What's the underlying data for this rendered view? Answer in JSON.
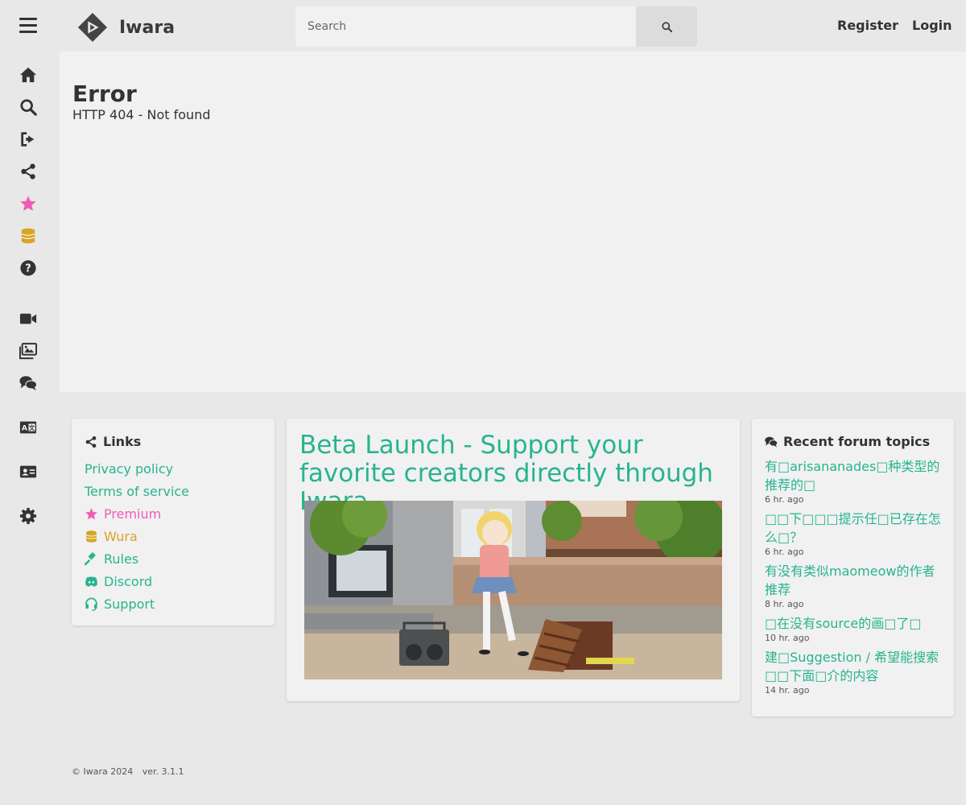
{
  "header": {
    "logo_text": "Iwara",
    "search_placeholder": "Search",
    "register_label": "Register",
    "login_label": "Login"
  },
  "sidebar": {
    "items": [
      "home-icon",
      "search-icon",
      "sign-out-icon",
      "share-icon",
      "star-icon",
      "coins-icon",
      "question-icon",
      "video-icon",
      "images-icon",
      "comments-icon",
      "language-icon",
      "id-card-icon",
      "gear-icon"
    ]
  },
  "error": {
    "title": "Error",
    "message": "HTTP 404 - Not found"
  },
  "links_card": {
    "heading": "Links",
    "items": {
      "privacy": "Privacy policy",
      "terms": "Terms of service",
      "premium": "Premium",
      "wura": "Wura",
      "rules": "Rules",
      "discord": "Discord",
      "support": "Support"
    }
  },
  "beta_card": {
    "title": "Beta Launch - Support your favorite creators directly through Iwara"
  },
  "forum_card": {
    "heading": "Recent forum topics",
    "topics": [
      {
        "title": "有□arisananades□种类型的推荐的□",
        "time": "6 hr. ago"
      },
      {
        "title": "□□下□□□提示任□已存在怎么□？",
        "time": "6 hr. ago"
      },
      {
        "title": "有没有类似maomeow的作者推荐",
        "time": "8 hr. ago"
      },
      {
        "title": "□在没有source的画□了□",
        "time": "10 hr. ago"
      },
      {
        "title": "建□Suggestion / 希望能搜索□□下面□介的内容",
        "time": "14 hr. ago"
      }
    ]
  },
  "footer": {
    "copyright": "© Iwara 2024",
    "version": "ver. 3.1.1"
  },
  "colors": {
    "accent": "#27b48f",
    "premium": "#ef5cb8",
    "wura": "#d9a521",
    "background": "#e8e8e8",
    "panel": "#f1f1f1"
  }
}
